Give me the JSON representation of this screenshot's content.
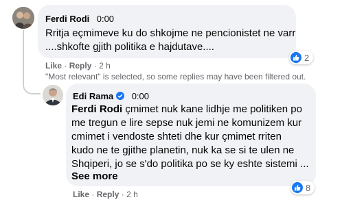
{
  "comment": {
    "author": "Ferdi Rodi",
    "time": "0:00",
    "lines": [
      "Rritja eçmimeve ku do shkojme ne pencionistet ne varr",
      "....shkofte gjith politika e hajdutave...."
    ],
    "reactions": "2",
    "actions": {
      "like": "Like",
      "dot": "·",
      "reply": "Reply",
      "age": "2 h"
    }
  },
  "filter_notice": "\"Most relevant\" is selected, so some replies may have been filtered out.",
  "reply": {
    "author": "Edi Rama",
    "time": "0:00",
    "mention": "Ferdi Rodi",
    "first_line_rest": " çmimet nuk kane lidhje me politiken po",
    "lines": [
      "me tregun e lire sepse nuk jemi ne komunizem kur",
      "cmimet i vendoste shteti dhe kur çmimet rriten",
      "kudo ne te gjithe planetin, nuk ka se si te ulen ne",
      "Shqiperi, jo se s'do politika po se ky eshte sistemi ..."
    ],
    "see_more": "See more",
    "reactions": "8",
    "actions": {
      "like": "Like",
      "dot": "·",
      "reply": "Reply",
      "age": "2 h"
    }
  },
  "colors": {
    "accent": "#1877f2",
    "bubble": "#f0f2f5",
    "secondary_text": "#65676b"
  }
}
